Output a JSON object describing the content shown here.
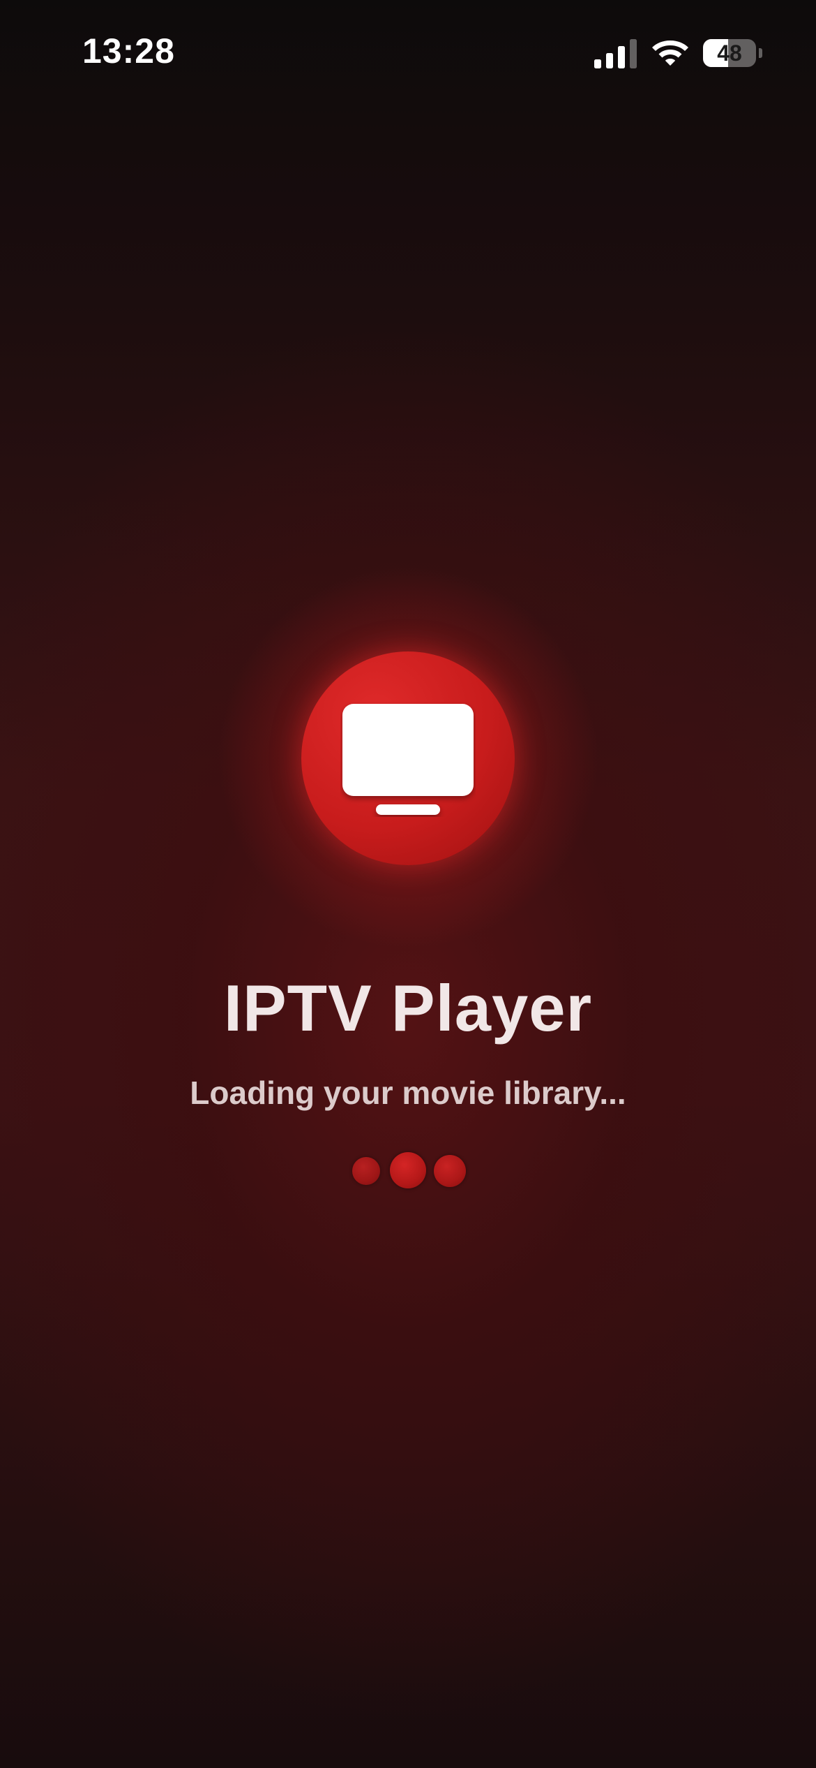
{
  "status_bar": {
    "time": "13:28",
    "battery_level": "48",
    "battery_fraction": 0.48
  },
  "app": {
    "title": "IPTV Player",
    "loading_message": "Loading your movie library..."
  },
  "icons": {
    "logo": "tv-icon",
    "signal": "cellular-signal-icon",
    "wifi": "wifi-icon",
    "battery": "battery-icon"
  },
  "colors": {
    "accent": "#cc1f1f",
    "background": "#3a1314",
    "title_text": "#f1e7e7",
    "subtitle_text": "#dccbcb"
  },
  "loading_indicator": {
    "dot_count": 3
  }
}
